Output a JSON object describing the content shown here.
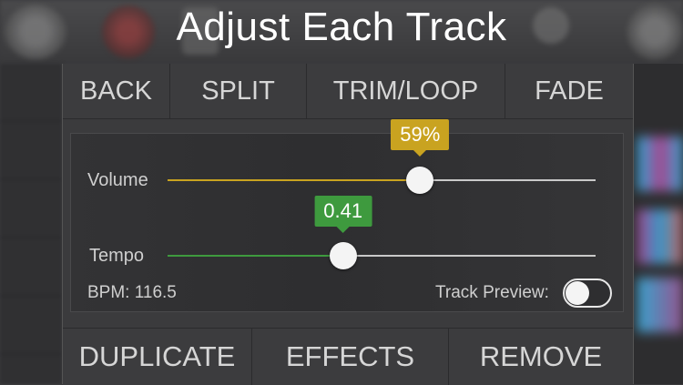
{
  "title": "Adjust Each Track",
  "top_nav": {
    "back": "BACK",
    "split": "SPLIT",
    "trim_loop": "TRIM/LOOP",
    "fade": "FADE"
  },
  "volume": {
    "label": "Volume",
    "value": 0.59,
    "display": "59%",
    "color": "#c9a320"
  },
  "tempo": {
    "label": "Tempo",
    "value": 0.41,
    "display": "0.41",
    "color": "#3e9a3e"
  },
  "bpm": "BPM: 116.5",
  "track_preview": {
    "label": "Track Preview:",
    "on": false
  },
  "bottom_nav": {
    "duplicate": "DUPLICATE",
    "effects": "EFFECTS",
    "remove": "REMOVE"
  }
}
